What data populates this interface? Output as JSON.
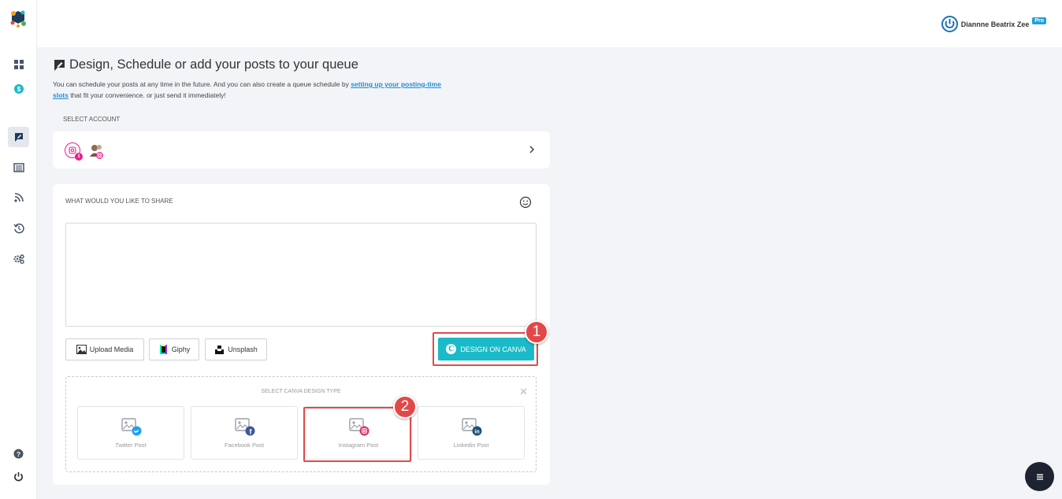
{
  "user": {
    "name": "Diannne Beatrix Zee",
    "badge": "Pro"
  },
  "sidebar": {
    "items": [
      {
        "icon": "dashboard-icon"
      },
      {
        "icon": "dollar-circle-icon"
      },
      {
        "icon": "compose-icon",
        "active": true
      },
      {
        "icon": "list-icon"
      },
      {
        "icon": "rss-icon"
      },
      {
        "icon": "history-icon"
      },
      {
        "icon": "settings-icon"
      }
    ],
    "bottom": [
      {
        "icon": "help-icon"
      },
      {
        "icon": "power-icon"
      }
    ]
  },
  "header": {
    "title": "Design, Schedule or add your posts to your queue",
    "desc_before": "You can schedule your posts at any time in the future. And you can also create a queue schedule by ",
    "desc_link": "setting up your posting-time slots",
    "desc_after": " that fit your convenience. or just send it immediately!"
  },
  "account": {
    "label": "SELECT ACCOUNT",
    "badge_count": "1"
  },
  "composer": {
    "label": "WHAT WOULD YOU LIKE TO SHARE",
    "text": "",
    "buttons": {
      "upload": "Upload Media",
      "giphy": "Giphy",
      "unsplash": "Unsplash"
    },
    "canva_button": "DESIGN ON CANVA"
  },
  "canva_types": {
    "label": "SELECT CANVA DESIGN TYPE",
    "items": [
      {
        "label": "Twitter Post",
        "color": "#1da1f2"
      },
      {
        "label": "Facebook Post",
        "color": "#3b5998"
      },
      {
        "label": "Instagram Post",
        "color": "#e1306c"
      },
      {
        "label": "Linkedin Post",
        "color": "#0e76a8"
      }
    ]
  },
  "annotations": {
    "step1": "1",
    "step2": "2"
  },
  "colors": {
    "accent": "#1bbac8",
    "highlight": "#e24a4a",
    "link": "#1f8fd0"
  }
}
